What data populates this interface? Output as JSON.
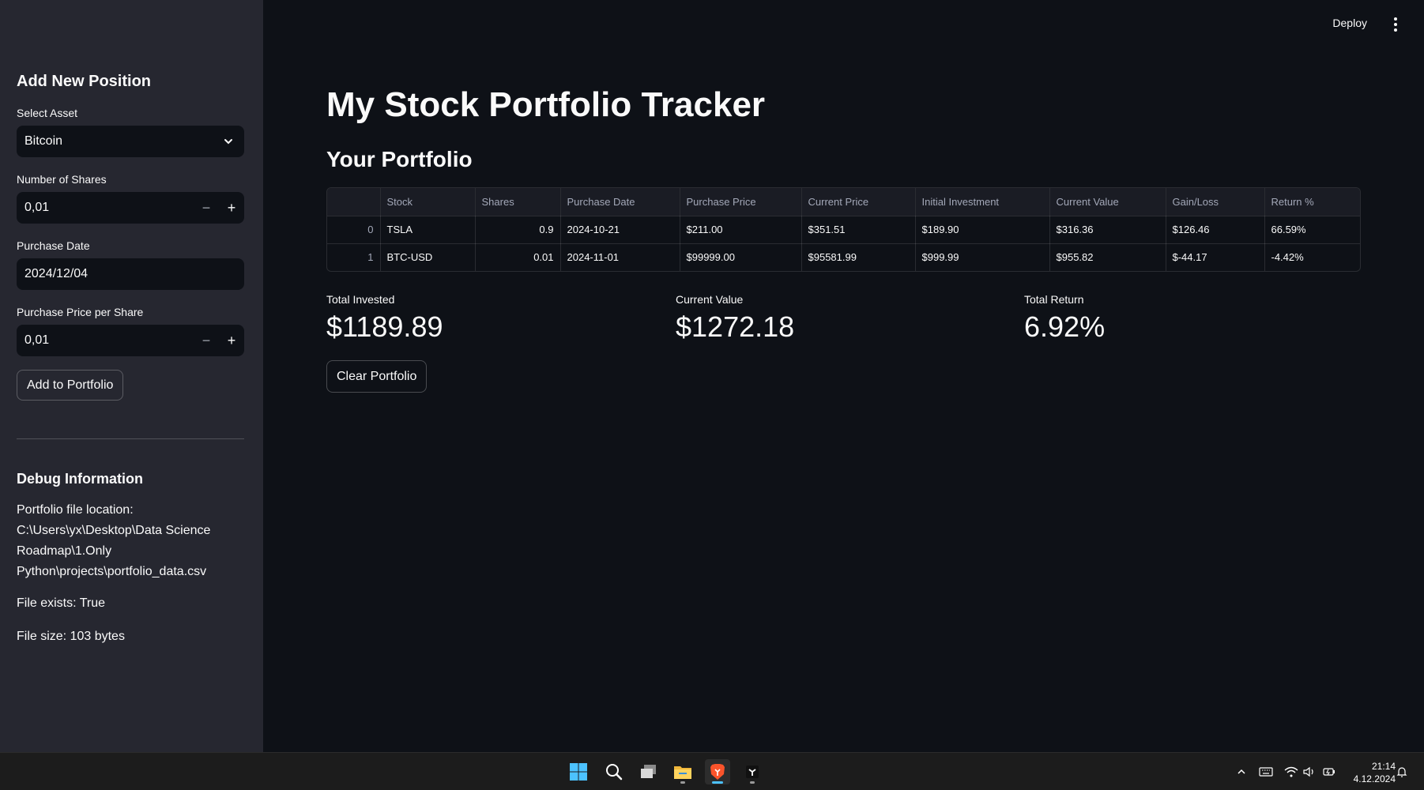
{
  "sidebar": {
    "add_heading": "Add New Position",
    "select_asset": {
      "label": "Select Asset",
      "value": "Bitcoin"
    },
    "shares": {
      "label": "Number of Shares",
      "value": "0,01",
      "minus": "−",
      "plus": "+"
    },
    "purchase_date": {
      "label": "Purchase Date",
      "value": "2024/12/04"
    },
    "price": {
      "label": "Purchase Price per Share",
      "value": "0,01",
      "minus": "−",
      "plus": "+"
    },
    "add_button": "Add to Portfolio",
    "debug_heading": "Debug Information",
    "debug_location_label": "Portfolio file location:",
    "debug_location_lines": [
      "C:\\Users\\yx\\Desktop\\Data Science",
      "Roadmap\\1.Only",
      "Python\\projects\\portfolio_data.csv"
    ],
    "debug_exists": "File exists: True",
    "debug_size": "File size: 103 bytes"
  },
  "header": {
    "deploy": "Deploy"
  },
  "main": {
    "title": "My Stock Portfolio Tracker",
    "subtitle": "Your Portfolio",
    "table": {
      "columns": [
        "",
        "Stock",
        "Shares",
        "Purchase Date",
        "Purchase Price",
        "Current Price",
        "Initial Investment",
        "Current Value",
        "Gain/Loss",
        "Return %"
      ],
      "rows": [
        [
          "0",
          "TSLA",
          "0.9",
          "2024-10-21",
          "$211.00",
          "$351.51",
          "$189.90",
          "$316.36",
          "$126.46",
          "66.59%"
        ],
        [
          "1",
          "BTC-USD",
          "0.01",
          "2024-11-01",
          "$99999.00",
          "$95581.99",
          "$999.99",
          "$955.82",
          "$-44.17",
          "-4.42%"
        ]
      ]
    },
    "metrics": [
      {
        "label": "Total Invested",
        "value": "$1189.89"
      },
      {
        "label": "Current Value",
        "value": "$1272.18"
      },
      {
        "label": "Total Return",
        "value": "6.92%"
      }
    ],
    "clear_button": "Clear Portfolio"
  },
  "taskbar": {
    "apps": [
      "windows-start-icon",
      "search-icon",
      "task-view-icon",
      "file-explorer-icon",
      "brave-browser-icon",
      "terminal-app-icon"
    ],
    "time": "21:14",
    "date": "4.12.2024"
  },
  "colors": {
    "background": "#0e1117",
    "sidebar": "#262730",
    "text": "#fafafa",
    "taskbar": "#1c1c1c"
  }
}
